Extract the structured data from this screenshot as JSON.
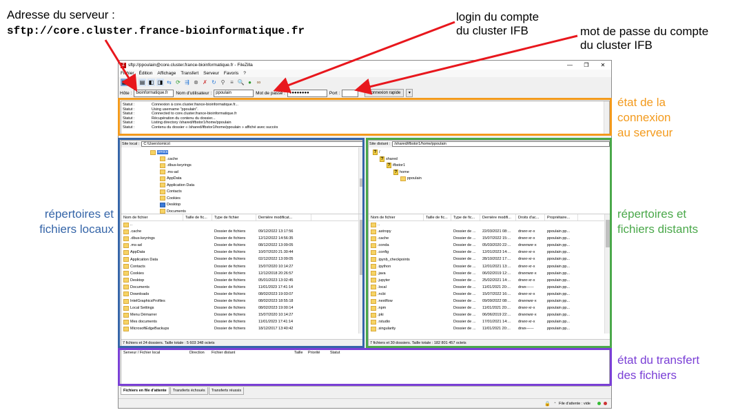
{
  "annotations": {
    "server_address_label": "Adresse du serveur :",
    "server_address_value": "sftp://core.cluster.france-bioinformatique.fr",
    "login_line1": "login du compte",
    "login_line2": "du cluster IFB",
    "password_line1": "mot de passe du compte",
    "password_line2": "du cluster IFB",
    "connection_state_line1": "état de la",
    "connection_state_line2": "connexion",
    "connection_state_line3": "au serveur",
    "local_line1": "répertoires et",
    "local_line2": "fichiers locaux",
    "remote_line1": "répertoires et",
    "remote_line2": "fichiers distants",
    "transfer_line1": "état du transfert",
    "transfer_line2": "des fichiers",
    "colors": {
      "red": "#e8171d",
      "orange": "#f39a1c",
      "blue": "#3565a8",
      "green": "#4aa84a",
      "purple": "#7a3fd6"
    }
  },
  "window": {
    "title": "sftp://ppoulain@core.cluster.france-bioinformatique.fr - FileZilla",
    "buttons": [
      "—",
      "❐",
      "✕"
    ]
  },
  "menu": [
    "Fichier",
    "Édition",
    "Affichage",
    "Transfert",
    "Serveur",
    "Favoris",
    "?"
  ],
  "quickconnect": {
    "host_label": "Hôte :",
    "host_value": "bioinformatique.fr",
    "user_label": "Nom d'utilisateur :",
    "user_value": "ppoulain",
    "password_label": "Mot de passe :",
    "password_value": "●●●●●●●●",
    "port_label": "Port :",
    "port_value": "",
    "connect_button": "Connexion rapide",
    "dropdown": "▾"
  },
  "status_log": [
    {
      "k": "Statut :",
      "v": "Connexion à core.cluster.france-bioinformatique.fr..."
    },
    {
      "k": "Statut :",
      "v": "Using username \"ppoulain\"."
    },
    {
      "k": "Statut :",
      "v": "Connected to core.cluster.france-bioinformatique.fr"
    },
    {
      "k": "Statut :",
      "v": "Récupération du contenu du dossier..."
    },
    {
      "k": "Statut :",
      "v": "Listing directory /shared/ifbstor1/home/ppoulain"
    },
    {
      "k": "Statut :",
      "v": "Contenu du dossier « /shared/ifbstor1/home/ppoulain » affiché avec succès"
    }
  ],
  "local": {
    "site_label": "Site local :",
    "path": "C:\\Users\\omics\\",
    "tree": [
      {
        "label": "omics",
        "indent": 0,
        "selected": true,
        "person": true
      },
      {
        "label": ".cache",
        "indent": 1
      },
      {
        "label": ".dbus-keyrings",
        "indent": 1
      },
      {
        "label": ".ms-ad",
        "indent": 1
      },
      {
        "label": "AppData",
        "indent": 1
      },
      {
        "label": "Application Data",
        "indent": 1
      },
      {
        "label": "Contacts",
        "indent": 1
      },
      {
        "label": "Cookies",
        "indent": 1
      },
      {
        "label": "Desktop",
        "indent": 1,
        "blue": true
      },
      {
        "label": "Documents",
        "indent": 1
      }
    ],
    "columns": [
      "Nom de fichier",
      "Taille de fic...",
      "Type de fichier",
      "Dernière modificat..."
    ],
    "rows": [
      [
        "..",
        "",
        "",
        ""
      ],
      [
        ".cache",
        "",
        "Dossier de fichiers",
        "09/12/2022 13:17:56"
      ],
      [
        ".dbus-keyrings",
        "",
        "Dossier de fichiers",
        "12/12/2022 14:56:35"
      ],
      [
        ".ms-ad",
        "",
        "Dossier de fichiers",
        "08/12/2022 13:09:05"
      ],
      [
        "AppData",
        "",
        "Dossier de fichiers",
        "10/07/2020 21:30:44"
      ],
      [
        "Application Data",
        "",
        "Dossier de fichiers",
        "02/12/2022 13:09:05"
      ],
      [
        "Contacts",
        "",
        "Dossier de fichiers",
        "15/07/2020 10:14:27"
      ],
      [
        "Cookies",
        "",
        "Dossier de fichiers",
        "12/12/2018 20:26:57"
      ],
      [
        "Desktop",
        "",
        "Dossier de fichiers",
        "05/01/2023 13:02:45"
      ],
      [
        "Documents",
        "",
        "Dossier de fichiers",
        "11/01/2023 17:41:14"
      ],
      [
        "Downloads",
        "",
        "Dossier de fichiers",
        "08/02/2023 19:03:07"
      ],
      [
        "IntelGraphicsProfiles",
        "",
        "Dossier de fichiers",
        "08/02/2023 18:55:18"
      ],
      [
        "Local Settings",
        "",
        "Dossier de fichiers",
        "08/02/2023 19:00:14"
      ],
      [
        "Menu Démarrer",
        "",
        "Dossier de fichiers",
        "15/07/2020 10:14:27"
      ],
      [
        "Mes documents",
        "",
        "Dossier de fichiers",
        "11/01/2023 17:41:14"
      ],
      [
        "MicrosoftEdgeBackups",
        "",
        "Dossier de fichiers",
        "18/12/2017 13:40:42"
      ]
    ],
    "summary": "7 fichiers et 24 dossiers. Taille totale : 5 603 348 octets"
  },
  "remote": {
    "site_label": "Site distant :",
    "path": "/shared/ifbstor1/home/ppoulain",
    "tree": [
      {
        "label": "/",
        "indent": 0
      },
      {
        "label": "shared",
        "indent": 1
      },
      {
        "label": "ifbstor1",
        "indent": 2
      },
      {
        "label": "home",
        "indent": 3
      },
      {
        "label": "ppoulain",
        "indent": 4,
        "folder": true
      }
    ],
    "columns": [
      "Nom de fichier",
      "Taille de fic...",
      "Type de fic...",
      "Dernière modifi...",
      "Droits d'ac...",
      "Propriétaire..."
    ],
    "rows": [
      [
        "..",
        "",
        "",
        "",
        "",
        ""
      ],
      [
        ".astropy",
        "",
        "Dossier de ...",
        "22/03/2021 08:...",
        "drwxr-xr-x",
        "ppoulain pp..."
      ],
      [
        ".cache",
        "",
        "Dossier de ...",
        "15/07/2022 15:...",
        "drwxr-xr-x",
        "ppoulain pp..."
      ],
      [
        ".conda",
        "",
        "Dossier de ...",
        "05/03/2020 22:...",
        "drwxrwxr-x",
        "ppoulain pp..."
      ],
      [
        ".config",
        "",
        "Dossier de ...",
        "12/01/2023 14:...",
        "drwxr-xr-x",
        "ppoulain pp..."
      ],
      [
        ".ipynb_checkpoints",
        "",
        "Dossier de ...",
        "28/10/2022 17:...",
        "drwxr-xr-x",
        "ppoulain pp..."
      ],
      [
        ".ipython",
        "",
        "Dossier de ...",
        "12/01/2021 13:...",
        "drwxr-xr-x",
        "ppoulain pp..."
      ],
      [
        ".java",
        "",
        "Dossier de ...",
        "06/02/2019 12:...",
        "drwxrwxr-x",
        "ppoulain pp..."
      ],
      [
        ".jupyter",
        "",
        "Dossier de ...",
        "25/02/2021 14:...",
        "drwxr-xr-x",
        "ppoulain pp..."
      ],
      [
        ".local",
        "",
        "Dossier de ...",
        "11/01/2021 20:...",
        "drwx------",
        "ppoulain pp..."
      ],
      [
        ".ncbi",
        "",
        "Dossier de ...",
        "15/07/2022 16:...",
        "drwxr-xr-x",
        "ppoulain pp..."
      ],
      [
        ".nextflow",
        "",
        "Dossier de ...",
        "09/09/2022 08:...",
        "drwxrwxr-x",
        "ppoulain pp..."
      ],
      [
        ".npm",
        "",
        "Dossier de ...",
        "11/01/2021 20:...",
        "drwxr-xr-x",
        "ppoulain pp..."
      ],
      [
        ".pki",
        "",
        "Dossier de ...",
        "06/06/2019 22:...",
        "drwxrwxr-x",
        "ppoulain pp..."
      ],
      [
        ".rstudio",
        "",
        "Dossier de ...",
        "17/01/2021 14:...",
        "drwxr-xr-x",
        "ppoulain pp..."
      ],
      [
        ".singularity",
        "",
        "Dossier de ...",
        "11/01/2021 20:...",
        "drwx------",
        "ppoulain pp..."
      ]
    ],
    "summary": "7 fichiers et 30 dossiers. Taille totale : 182 801 457 octets"
  },
  "queue": {
    "columns": [
      "Serveur / Fichier local",
      "Direction",
      "Fichier distant",
      "Taille",
      "Priorité",
      "Statut"
    ],
    "tabs": [
      "Fichiers en file d'attente",
      "Transferts échoués",
      "Transferts réussis"
    ]
  },
  "statusbar": {
    "queue_text": "File d'attente : vide"
  }
}
